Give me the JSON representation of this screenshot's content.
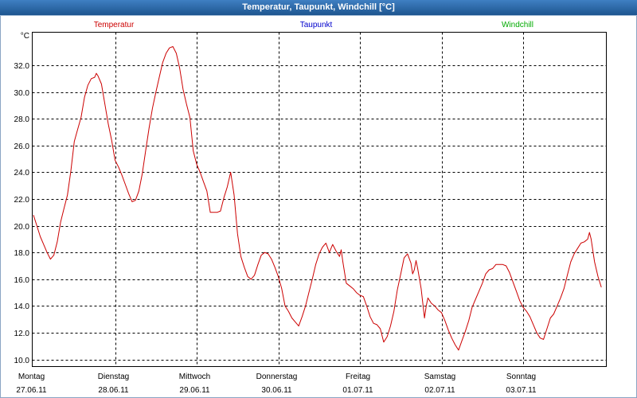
{
  "chart_data": {
    "type": "line",
    "title": "Temperatur, Taupunkt, Windchill [°C]",
    "ylabel": "°C",
    "ylim": [
      9.5,
      34.5
    ],
    "xlim": [
      "27.06.11 00:00",
      "04.07.11 00:00"
    ],
    "grid": true,
    "legend_position": "top",
    "ytick_labels": [
      "10.0",
      "12.0",
      "14.0",
      "16.0",
      "18.0",
      "20.0",
      "22.0",
      "24.0",
      "26.0",
      "28.0",
      "30.0",
      "32.0"
    ],
    "days": [
      {
        "day": "Montag",
        "date": "27.06.11"
      },
      {
        "day": "Dienstag",
        "date": "28.06.11"
      },
      {
        "day": "Mittwoch",
        "date": "29.06.11"
      },
      {
        "day": "Donnerstag",
        "date": "30.06.11"
      },
      {
        "day": "Freitag",
        "date": "01.07.11"
      },
      {
        "day": "Samstag",
        "date": "02.07.11"
      },
      {
        "day": "Sonntag",
        "date": "03.07.11"
      }
    ],
    "series": [
      {
        "name": "Temperatur",
        "color": "#cc0000",
        "points": [
          [
            "27.06.11 00:00",
            20.8
          ],
          [
            "27.06.11 01:00",
            20.0
          ],
          [
            "27.06.11 02:00",
            19.2
          ],
          [
            "27.06.11 03:00",
            18.6
          ],
          [
            "27.06.11 04:00",
            18.0
          ],
          [
            "27.06.11 05:00",
            17.5
          ],
          [
            "27.06.11 06:00",
            17.8
          ],
          [
            "27.06.11 07:00",
            18.8
          ],
          [
            "27.06.11 08:00",
            20.3
          ],
          [
            "27.06.11 09:00",
            21.3
          ],
          [
            "27.06.11 10:00",
            22.3
          ],
          [
            "27.06.11 11:00",
            24.1
          ],
          [
            "27.06.11 12:00",
            26.3
          ],
          [
            "27.06.11 13:00",
            27.2
          ],
          [
            "27.06.11 14:00",
            28.1
          ],
          [
            "27.06.11 15:00",
            29.6
          ],
          [
            "27.06.11 16:00",
            30.5
          ],
          [
            "27.06.11 17:00",
            31.0
          ],
          [
            "27.06.11 18:00",
            31.1
          ],
          [
            "27.06.11 18:30",
            31.4
          ],
          [
            "27.06.11 19:00",
            31.2
          ],
          [
            "27.06.11 20:00",
            30.6
          ],
          [
            "27.06.11 21:00",
            29.1
          ],
          [
            "27.06.11 22:00",
            27.6
          ],
          [
            "27.06.11 23:00",
            26.4
          ],
          [
            "28.06.11 00:00",
            24.9
          ],
          [
            "28.06.11 01:00",
            24.4
          ],
          [
            "28.06.11 02:00",
            23.8
          ],
          [
            "28.06.11 03:00",
            23.1
          ],
          [
            "28.06.11 04:00",
            22.4
          ],
          [
            "28.06.11 05:00",
            21.8
          ],
          [
            "28.06.11 06:00",
            21.9
          ],
          [
            "28.06.11 07:00",
            22.6
          ],
          [
            "28.06.11 08:00",
            23.9
          ],
          [
            "28.06.11 09:00",
            25.6
          ],
          [
            "28.06.11 10:00",
            27.3
          ],
          [
            "28.06.11 11:00",
            28.8
          ],
          [
            "28.06.11 12:00",
            30.0
          ],
          [
            "28.06.11 13:00",
            31.1
          ],
          [
            "28.06.11 14:00",
            32.2
          ],
          [
            "28.06.11 15:00",
            32.9
          ],
          [
            "28.06.11 16:00",
            33.3
          ],
          [
            "28.06.11 17:00",
            33.4
          ],
          [
            "28.06.11 18:00",
            32.9
          ],
          [
            "28.06.11 19:00",
            31.8
          ],
          [
            "28.06.11 20:00",
            30.2
          ],
          [
            "28.06.11 21:00",
            29.1
          ],
          [
            "28.06.11 22:00",
            28.1
          ],
          [
            "28.06.11 23:00",
            25.6
          ],
          [
            "29.06.11 00:00",
            24.6
          ],
          [
            "29.06.11 01:00",
            24.0
          ],
          [
            "29.06.11 02:00",
            23.3
          ],
          [
            "29.06.11 03:00",
            22.6
          ],
          [
            "29.06.11 04:00",
            21.0
          ],
          [
            "29.06.11 05:00",
            21.0
          ],
          [
            "29.06.11 06:00",
            21.0
          ],
          [
            "29.06.11 07:00",
            21.1
          ],
          [
            "29.06.11 08:00",
            22.1
          ],
          [
            "29.06.11 09:00",
            22.9
          ],
          [
            "29.06.11 10:00",
            24.0
          ],
          [
            "29.06.11 11:00",
            22.3
          ],
          [
            "29.06.11 12:00",
            19.4
          ],
          [
            "29.06.11 13:00",
            17.7
          ],
          [
            "29.06.11 14:00",
            16.9
          ],
          [
            "29.06.11 15:00",
            16.2
          ],
          [
            "29.06.11 16:00",
            16.0
          ],
          [
            "29.06.11 17:00",
            16.3
          ],
          [
            "29.06.11 18:00",
            17.1
          ],
          [
            "29.06.11 19:00",
            17.8
          ],
          [
            "29.06.11 20:00",
            18.0
          ],
          [
            "29.06.11 21:00",
            17.9
          ],
          [
            "29.06.11 22:00",
            17.5
          ],
          [
            "29.06.11 23:00",
            16.9
          ],
          [
            "30.06.11 00:00",
            16.2
          ],
          [
            "30.06.11 01:00",
            15.3
          ],
          [
            "30.06.11 02:00",
            14.0
          ],
          [
            "30.06.11 03:00",
            13.6
          ],
          [
            "30.06.11 04:00",
            13.1
          ],
          [
            "30.06.11 05:00",
            12.8
          ],
          [
            "30.06.11 06:00",
            12.5
          ],
          [
            "30.06.11 07:00",
            13.2
          ],
          [
            "30.06.11 08:00",
            14.0
          ],
          [
            "30.06.11 09:00",
            15.0
          ],
          [
            "30.06.11 10:00",
            16.0
          ],
          [
            "30.06.11 11:00",
            17.1
          ],
          [
            "30.06.11 12:00",
            17.9
          ],
          [
            "30.06.11 13:00",
            18.4
          ],
          [
            "30.06.11 14:00",
            18.7
          ],
          [
            "30.06.11 15:00",
            18.0
          ],
          [
            "30.06.11 16:00",
            18.6
          ],
          [
            "30.06.11 17:00",
            18.1
          ],
          [
            "30.06.11 18:00",
            17.7
          ],
          [
            "30.06.11 18:30",
            18.2
          ],
          [
            "30.06.11 19:00",
            17.3
          ],
          [
            "30.06.11 20:00",
            15.7
          ],
          [
            "30.06.11 21:00",
            15.5
          ],
          [
            "30.06.11 22:00",
            15.3
          ],
          [
            "30.06.11 23:00",
            15.0
          ],
          [
            "01.07.11 00:00",
            14.8
          ],
          [
            "01.07.11 01:00",
            14.7
          ],
          [
            "01.07.11 02:00",
            14.0
          ],
          [
            "01.07.11 03:00",
            13.2
          ],
          [
            "01.07.11 04:00",
            12.7
          ],
          [
            "01.07.11 05:00",
            12.6
          ],
          [
            "01.07.11 06:00",
            12.3
          ],
          [
            "01.07.11 07:00",
            11.3
          ],
          [
            "01.07.11 08:00",
            11.7
          ],
          [
            "01.07.11 09:00",
            12.5
          ],
          [
            "01.07.11 10:00",
            13.6
          ],
          [
            "01.07.11 11:00",
            15.2
          ],
          [
            "01.07.11 12:00",
            16.4
          ],
          [
            "01.07.11 13:00",
            17.6
          ],
          [
            "01.07.11 14:00",
            17.9
          ],
          [
            "01.07.11 15:00",
            17.2
          ],
          [
            "01.07.11 15:30",
            16.4
          ],
          [
            "01.07.11 16:00",
            16.7
          ],
          [
            "01.07.11 16:30",
            17.4
          ],
          [
            "01.07.11 17:00",
            16.8
          ],
          [
            "01.07.11 18:00",
            15.3
          ],
          [
            "01.07.11 19:00",
            13.1
          ],
          [
            "01.07.11 19:30",
            14.0
          ],
          [
            "01.07.11 20:00",
            14.6
          ],
          [
            "01.07.11 21:00",
            14.2
          ],
          [
            "01.07.11 22:00",
            14.0
          ],
          [
            "01.07.11 23:00",
            13.7
          ],
          [
            "02.07.11 00:00",
            13.5
          ],
          [
            "02.07.11 01:00",
            12.9
          ],
          [
            "02.07.11 02:00",
            12.2
          ],
          [
            "02.07.11 03:00",
            11.6
          ],
          [
            "02.07.11 04:00",
            11.1
          ],
          [
            "02.07.11 05:00",
            10.7
          ],
          [
            "02.07.11 06:00",
            11.4
          ],
          [
            "02.07.11 07:00",
            12.1
          ],
          [
            "02.07.11 08:00",
            12.9
          ],
          [
            "02.07.11 09:00",
            13.9
          ],
          [
            "02.07.11 10:00",
            14.5
          ],
          [
            "02.07.11 11:00",
            15.1
          ],
          [
            "02.07.11 12:00",
            15.7
          ],
          [
            "02.07.11 13:00",
            16.4
          ],
          [
            "02.07.11 14:00",
            16.7
          ],
          [
            "02.07.11 15:00",
            16.8
          ],
          [
            "02.07.11 16:00",
            17.1
          ],
          [
            "02.07.11 17:00",
            17.1
          ],
          [
            "02.07.11 18:00",
            17.1
          ],
          [
            "02.07.11 19:00",
            17.0
          ],
          [
            "02.07.11 20:00",
            16.5
          ],
          [
            "02.07.11 21:00",
            15.8
          ],
          [
            "02.07.11 22:00",
            15.1
          ],
          [
            "02.07.11 23:00",
            14.4
          ],
          [
            "03.07.11 00:00",
            13.9
          ],
          [
            "03.07.11 01:00",
            13.6
          ],
          [
            "03.07.11 02:00",
            13.2
          ],
          [
            "03.07.11 03:00",
            12.6
          ],
          [
            "03.07.11 04:00",
            12.0
          ],
          [
            "03.07.11 05:00",
            11.6
          ],
          [
            "03.07.11 06:00",
            11.5
          ],
          [
            "03.07.11 07:00",
            12.3
          ],
          [
            "03.07.11 08:00",
            13.1
          ],
          [
            "03.07.11 09:00",
            13.4
          ],
          [
            "03.07.11 10:00",
            14.0
          ],
          [
            "03.07.11 11:00",
            14.6
          ],
          [
            "03.07.11 12:00",
            15.3
          ],
          [
            "03.07.11 13:00",
            16.3
          ],
          [
            "03.07.11 14:00",
            17.3
          ],
          [
            "03.07.11 15:00",
            17.9
          ],
          [
            "03.07.11 16:00",
            18.3
          ],
          [
            "03.07.11 17:00",
            18.7
          ],
          [
            "03.07.11 18:00",
            18.8
          ],
          [
            "03.07.11 19:00",
            19.0
          ],
          [
            "03.07.11 19:30",
            19.5
          ],
          [
            "03.07.11 20:00",
            19.0
          ],
          [
            "03.07.11 21:00",
            17.3
          ],
          [
            "03.07.11 22:00",
            16.2
          ],
          [
            "03.07.11 23:00",
            15.4
          ]
        ]
      },
      {
        "name": "Taupunkt",
        "color": "#0000cc",
        "points": []
      },
      {
        "name": "Windchill",
        "color": "#00aa00",
        "points": []
      }
    ]
  }
}
